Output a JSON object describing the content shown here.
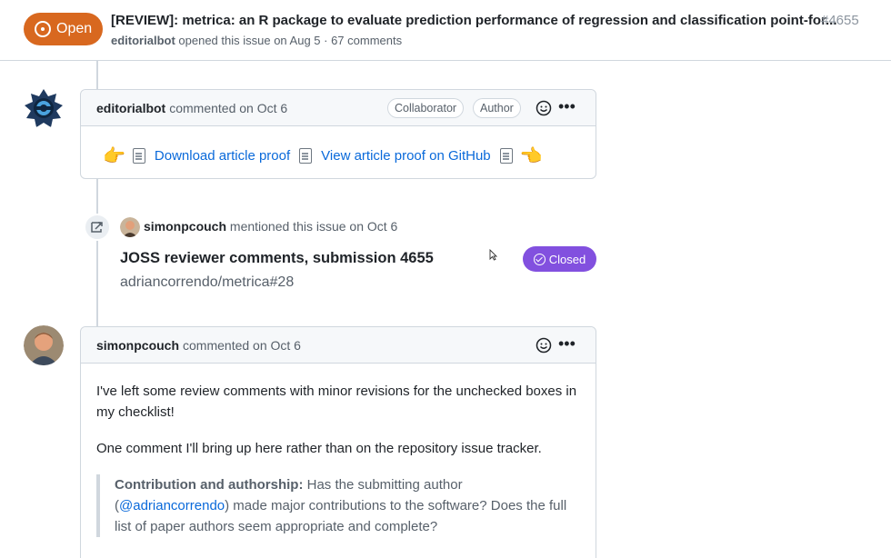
{
  "header": {
    "state_label": "Open",
    "title": "[REVIEW]: metrica: an R package to evaluate prediction performance of regression and classification point-for...",
    "number": "#4655",
    "author": "editorialbot",
    "meta": "opened this issue on Aug 5 · 67 comments"
  },
  "comment1": {
    "author": "editorialbot",
    "action": "commented on Oct 6",
    "labels": [
      "Collaborator",
      "Author"
    ],
    "download_link": "Download article proof",
    "view_link": "View article proof on GitHub"
  },
  "mention_event": {
    "user": "simonpcouch",
    "action": "mentioned this issue on Oct 6",
    "ref_title": "JOSS reviewer comments, submission 4655",
    "ref_repo": "adriancorrendo/metrica#28",
    "state_label": "Closed"
  },
  "comment2": {
    "author": "simonpcouch",
    "action": "commented on Oct 6",
    "para1": "I've left some review comments with minor revisions for the unchecked boxes in my checklist!",
    "para2": "One comment I'll bring up here rather than on the repository issue tracker.",
    "quote_bold": "Contribution and authorship:",
    "quote_pre": " Has the submitting author (",
    "quote_mention": "@adriancorrendo",
    "quote_post": ") made major contributions to the software? Does the full list of paper authors seem appropriate and complete?"
  },
  "colors": {
    "open_state": "#d8681f",
    "closed_state": "#8250df",
    "link": "#0969da"
  }
}
